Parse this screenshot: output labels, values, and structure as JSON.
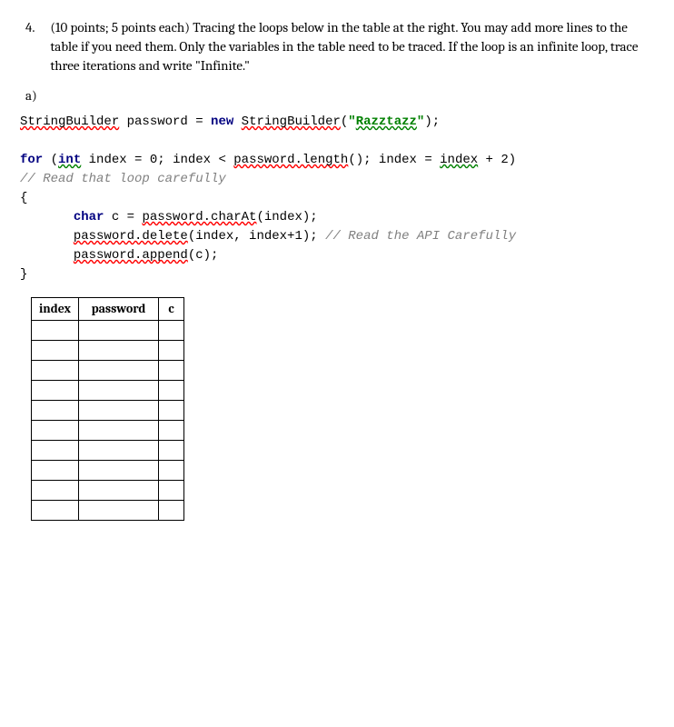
{
  "question": {
    "number": "4.",
    "prompt": "(10 points; 5 points each) Tracing the loops below in the table at the right. You may add more lines to the table if you need them.  Only the variables in the table need to be traced. If the loop is an infinite loop, trace three iterations and write \"Infinite.\"",
    "sub_label": "a)"
  },
  "code": {
    "line1_a": "StringBuilder",
    "line1_b": " password = ",
    "line1_new": "new",
    "line1_c": " ",
    "line1_d": "StringBuilder",
    "line1_e": "(",
    "line1_f": "\"",
    "line1_g": "Razztazz",
    "line1_h": "\"",
    "line1_i": ");",
    "line2_for": "for",
    "line2_a": " (",
    "line2_int": "int",
    "line2_b": " index = 0; index < ",
    "line2_c": "password.length",
    "line2_d": "(); index = ",
    "line2_e": "index",
    "line2_f": " + 2)",
    "line3": "// Read that loop carefully",
    "line4": "{",
    "line5_a": "       ",
    "line5_char": "char",
    "line5_b": " c = ",
    "line5_c": "password.charAt",
    "line5_d": "(index);",
    "line6_a": "       ",
    "line6_b": "password.delete",
    "line6_c": "(index, index+1); ",
    "line6_d": "// Read the API Carefully",
    "line7_a": "       ",
    "line7_b": "password.append",
    "line7_c": "(c);",
    "line8": "}"
  },
  "table": {
    "headers": [
      "index",
      "password",
      "c"
    ],
    "row_count": 10
  }
}
